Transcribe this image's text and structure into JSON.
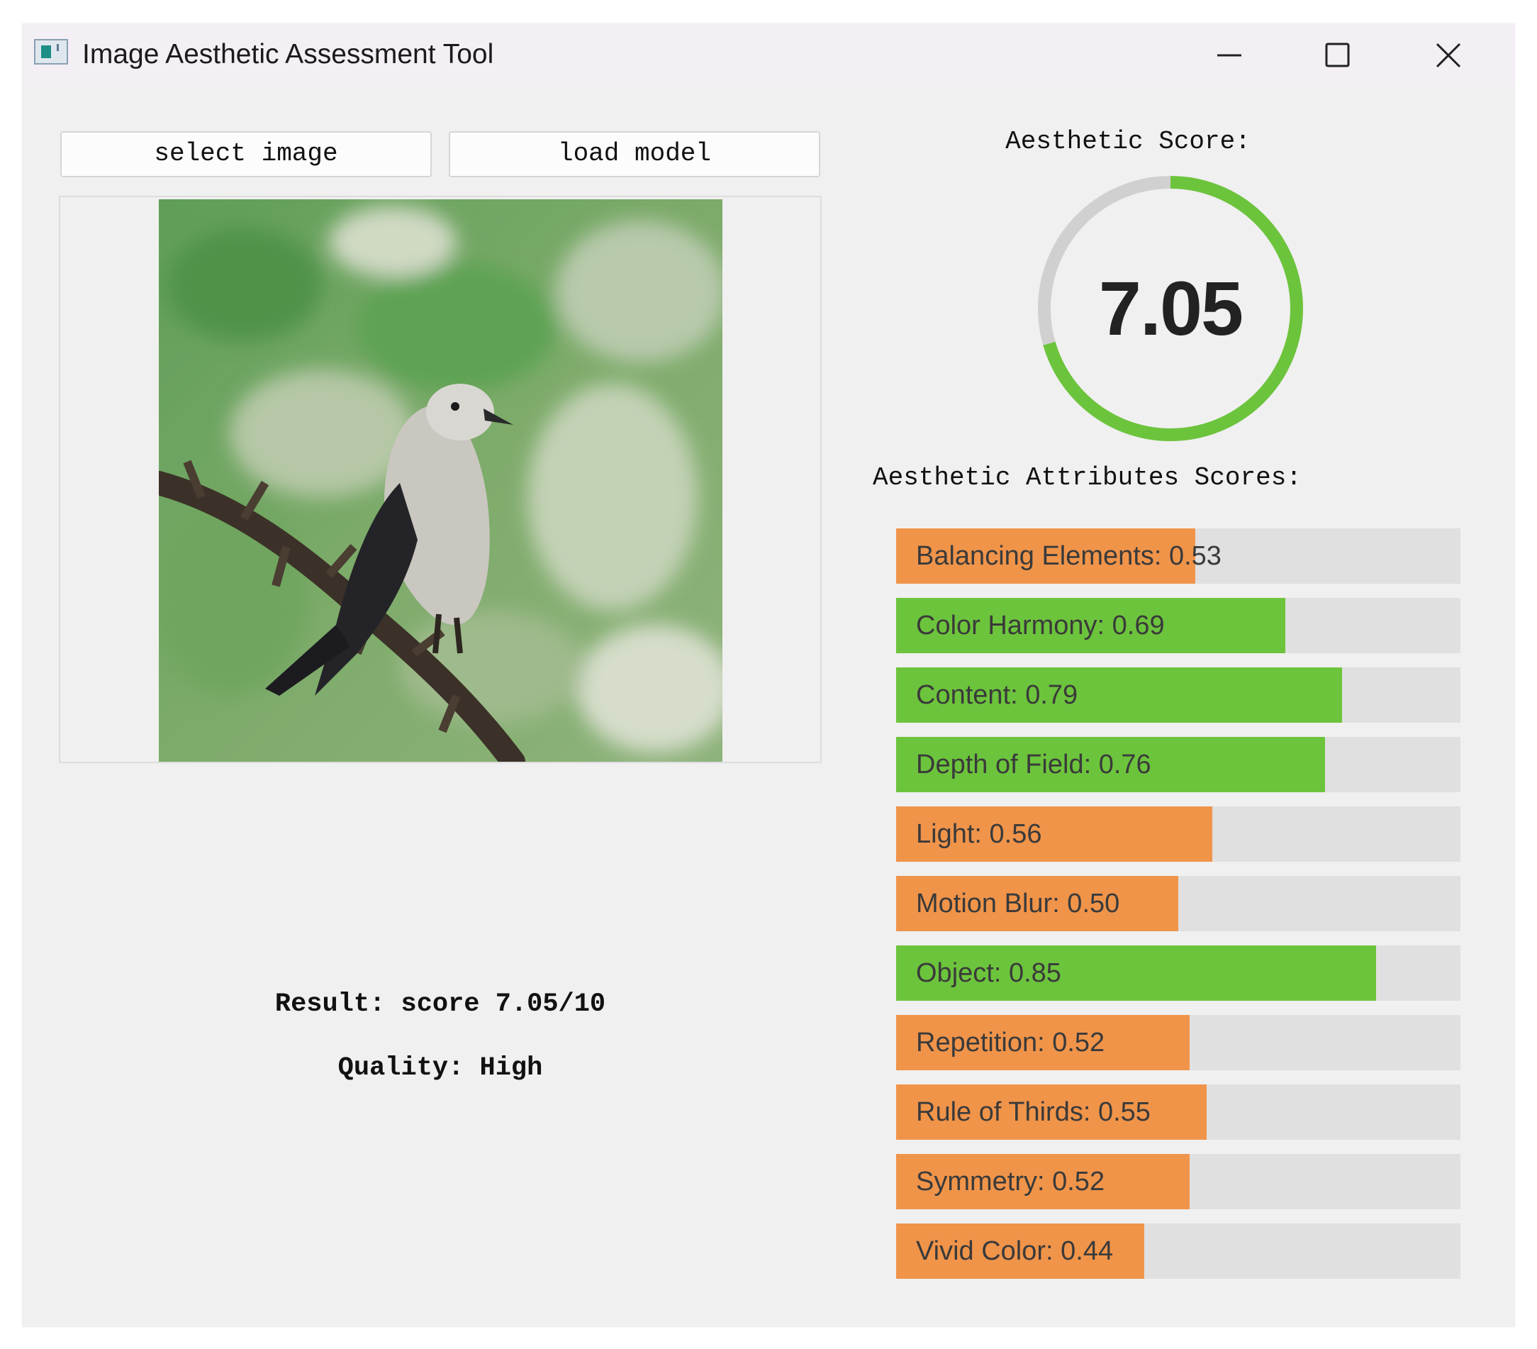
{
  "window": {
    "title": "Image Aesthetic Assessment Tool"
  },
  "toolbar": {
    "select_label": "select image",
    "load_label": "load model"
  },
  "score": {
    "title": "Aesthetic Score:",
    "value": "7.05",
    "max": 10,
    "ring_color": "#6cc43c",
    "track_color": "#d0d0d0"
  },
  "attributes": {
    "title": "Aesthetic Attributes Scores:",
    "high_color": "#6cc43c",
    "low_color": "#f0944a",
    "items": [
      {
        "label": "Balancing Elements: 0.53",
        "value": 0.53
      },
      {
        "label": "Color Harmony: 0.69",
        "value": 0.69
      },
      {
        "label": "Content: 0.79",
        "value": 0.79
      },
      {
        "label": "Depth of Field: 0.76",
        "value": 0.76
      },
      {
        "label": "Light: 0.56",
        "value": 0.56
      },
      {
        "label": "Motion Blur: 0.50",
        "value": 0.5
      },
      {
        "label": "Object: 0.85",
        "value": 0.85
      },
      {
        "label": "Repetition: 0.52",
        "value": 0.52
      },
      {
        "label": "Rule of Thirds: 0.55",
        "value": 0.55
      },
      {
        "label": "Symmetry: 0.52",
        "value": 0.52
      },
      {
        "label": "Vivid Color: 0.44",
        "value": 0.44
      }
    ]
  },
  "result": {
    "score_text": "Result: score 7.05/10",
    "quality_text": "Quality: High"
  }
}
